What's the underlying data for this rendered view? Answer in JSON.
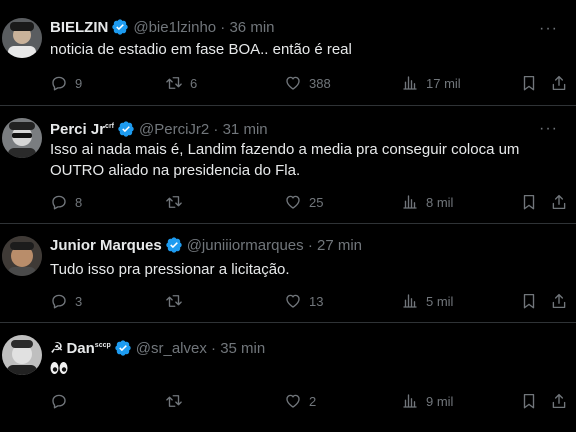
{
  "tweets": [
    {
      "name": "BIELZIN",
      "handle": "@bie1lzinho",
      "time": "36 min",
      "text": "noticia de estadio em fase BOA.. então é real",
      "replies": "9",
      "retweets": "6",
      "likes": "388",
      "views": "17 mil"
    },
    {
      "name": "Perci Jr",
      "name_badge": "crf",
      "handle": "@PerciJr2",
      "time": "31 min",
      "text_line1": "Isso ai nada mais é, Landim fazendo a media pra conseguir coloca um",
      "text_line2": "OUTRO aliado na presidencia do Fla.",
      "replies": "8",
      "retweets": "",
      "likes": "25",
      "views": "8 mil"
    },
    {
      "name": "Junior Marques",
      "handle": "@juniiiormarques",
      "time": "27 min",
      "text": "Tudo isso pra pressionar a licitação.",
      "replies": "3",
      "retweets": "",
      "likes": "13",
      "views": "5 mil"
    },
    {
      "name_prefix": "☭",
      "name": "Dan",
      "name_badge": "sccp",
      "handle": "@sr_alvex",
      "time": "35 min",
      "text_emoji": "eyes-emoji",
      "replies": "",
      "retweets": "",
      "likes": "2",
      "views": "9 mil"
    }
  ],
  "separator": "·",
  "colors": {
    "background": "#000000",
    "text": "#e7e9ea",
    "muted": "#71767b",
    "verified": "#1d9bf0",
    "border": "#2f3336"
  },
  "icons": [
    "reply-icon",
    "retweet-icon",
    "like-icon",
    "views-icon",
    "bookmark-icon",
    "share-icon",
    "verified-icon",
    "more-icon"
  ]
}
